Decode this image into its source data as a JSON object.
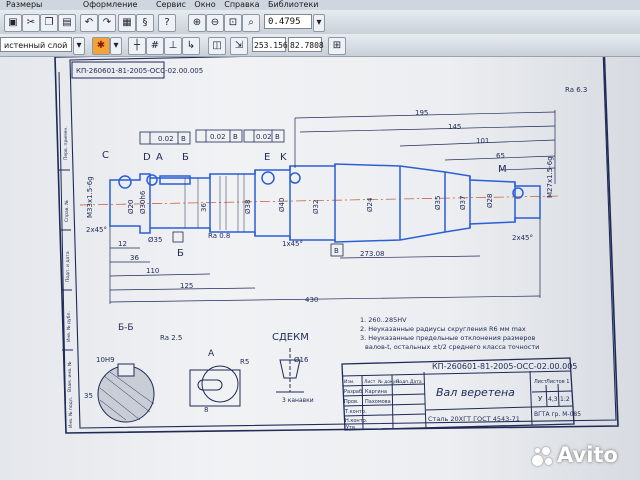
{
  "menu": {
    "items": [
      "Размеры",
      "Оформление",
      "Сервис",
      "Окно",
      "Справка",
      "Библиотеки"
    ]
  },
  "toolbar": {
    "zoom_value": "0.4795",
    "layer_select": "истенный слой (0)",
    "coord_x": "253.156",
    "coord_y": "82.7808"
  },
  "drawing": {
    "doc_code_mirror": "КП-260601-81-2005-ОСС-02.00.005",
    "roughness": "Ra 6.3",
    "dims": {
      "d195": "195",
      "d145": "145",
      "d101": "101",
      "d65": "65",
      "d110": "110",
      "d125": "125",
      "d36": "36",
      "d12": "12",
      "d430": "430",
      "chamfer_left": "2x45°",
      "chamfer_right": "2x45°",
      "chamfer_mid": "1x45°",
      "d30h6": "Ø30h6",
      "d20": "Ø20",
      "d40": "Ø40",
      "d35": "Ø35",
      "d24": "Ø24",
      "d32": "Ø32",
      "d37": "Ø37",
      "d38": "Ø38",
      "d28": "Ø28",
      "thread_left": "M33x1.5-6g",
      "thread_right": "M27x1.5-6g",
      "taper": "273.08",
      "ra08": "Ra 0.8"
    },
    "tolerance": {
      "runout": "0.02",
      "base": "B"
    },
    "labels": {
      "c": "C",
      "d": "D",
      "a": "A",
      "b": "Б",
      "e": "E",
      "k": "K",
      "m": "M",
      "b_box": "Б",
      "b_box2": "В"
    },
    "section": {
      "title": "Б-Б",
      "key": "10Н9",
      "size": "35",
      "ra": "Ra 2.5"
    },
    "detail_a": {
      "title": "А",
      "r5": "R5",
      "width": "8"
    },
    "detail_sdekm": {
      "title": "СДЕКМ",
      "size": "Ø16",
      "note": "3 канавки"
    },
    "notes": [
      "1. 260..285НV",
      "2. Неуказанные радиусы скругления R6 мм max",
      "3. Неуказанные предельные отклонения размеров",
      "валов-t, остальных ±t/2 среднего класса точности"
    ],
    "title_block": {
      "code": "КП-260601-81-2005-ОСС-02.00.005",
      "name": "Вал веретена",
      "material": "Сталь 20ХГТ ГОСТ 4543-71",
      "group": "ВГТА гр. М-085",
      "stage": "У",
      "mass": "4,3",
      "scale": "1:2",
      "roles": [
        "Разраб.",
        "Пров.",
        "Т.контр.",
        "Н.контр.",
        "Утв."
      ],
      "names": [
        "Каргина",
        "Пахомова"
      ],
      "col_heads": [
        "Изм.",
        "Лист",
        "№ докум.",
        "Подп.",
        "Дата"
      ],
      "sheet": "Лист",
      "sheets": "Листов 1"
    },
    "frame_left": [
      "Перв. примен.",
      "Справ. №",
      "Подп. и дата",
      "Инв. № дубл.",
      "Взам. инв. №",
      "Подп. и дата",
      "Инв. № подл."
    ]
  },
  "watermark": {
    "text": "Avito"
  },
  "colors": {
    "line": "#1f2a57",
    "axis": "#c8502a",
    "accent_blue": "#2a5fd6"
  }
}
